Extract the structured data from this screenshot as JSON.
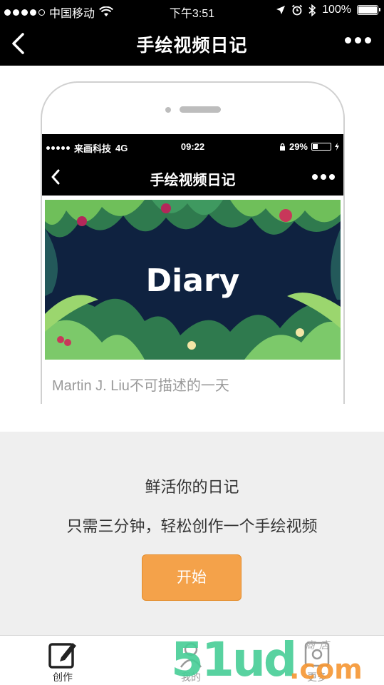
{
  "status_bar": {
    "carrier": "中国移动",
    "time": "下午3:51",
    "battery": "100%"
  },
  "nav": {
    "title": "手绘视频日记"
  },
  "preview": {
    "status": {
      "carrier": "来画科技",
      "network": "4G",
      "time": "09:22",
      "battery": "29%"
    },
    "title": "手绘视频日记",
    "banner_text": "Diary",
    "caption": "Martin J. Liu不可描述的一天"
  },
  "promo": {
    "headline": "鲜活你的日记",
    "subline": "只需三分钟，轻松创作一个手绘视频",
    "start_button": "开始"
  },
  "tabs": [
    {
      "label": "创作",
      "icon": "pencil-square-icon"
    },
    {
      "label": "我的",
      "icon": "user-icon"
    },
    {
      "label": "更多",
      "icon": "grid-icon"
    }
  ],
  "watermark": {
    "main": "51ud",
    "suffix": ".com",
    "store": "商店"
  },
  "colors": {
    "accent": "#f4a24a",
    "bar": "#000000",
    "panel": "#efefef",
    "banner_bg": "#0f2240"
  }
}
